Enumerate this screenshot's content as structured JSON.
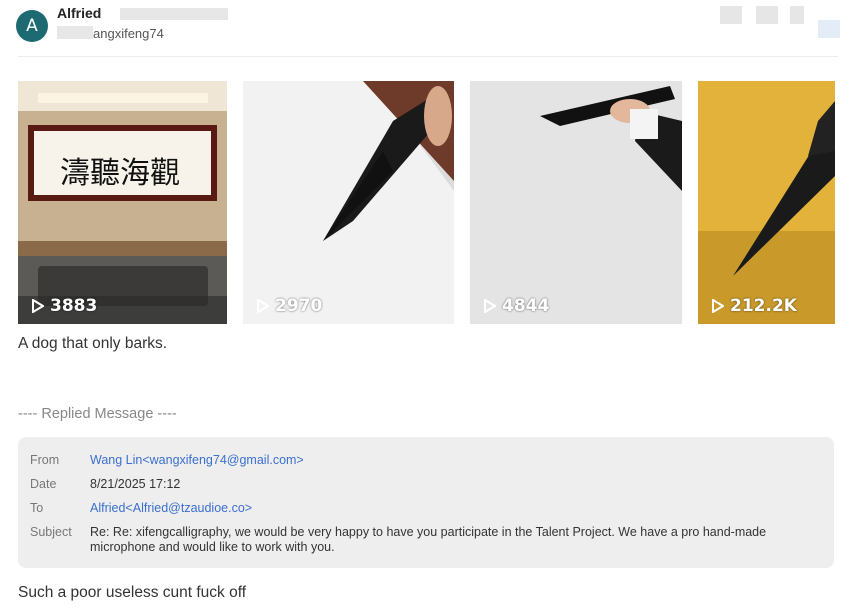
{
  "sender": {
    "avatar_initial": "A",
    "name": "Alfried",
    "handle": "angxifeng74"
  },
  "videos": [
    {
      "views": "3883",
      "image": "calligraphy-banner-in-conference-room"
    },
    {
      "views": "2970",
      "image": "brush-on-paper"
    },
    {
      "views": "4844",
      "image": "hand-holding-brush"
    },
    {
      "views": "212.2K",
      "image": "brush-on-yellow-paper"
    }
  ],
  "message": "A dog that only barks.",
  "replied_header": "---- Replied Message ----",
  "quoted": {
    "from_label": "From",
    "from_value": "Wang Lin<wangxifeng74@gmail.com>",
    "date_label": "Date",
    "date_value": "8/21/2025 17:12",
    "to_label": "To",
    "to_value": "Alfried<Alfried@tzaudioe.co>",
    "subject_label": "Subject",
    "subject_value": "Re: Re: xifengcalligraphy, we would be very happy to have you participate in the Talent Project. We have a pro hand-made microphone and would like to work with you."
  },
  "reply_text": "Such a poor useless cunt fuck off",
  "colors": {
    "avatar": "#1e6a73",
    "link": "#3a6fd0",
    "quote_bg": "#eeeeee"
  }
}
